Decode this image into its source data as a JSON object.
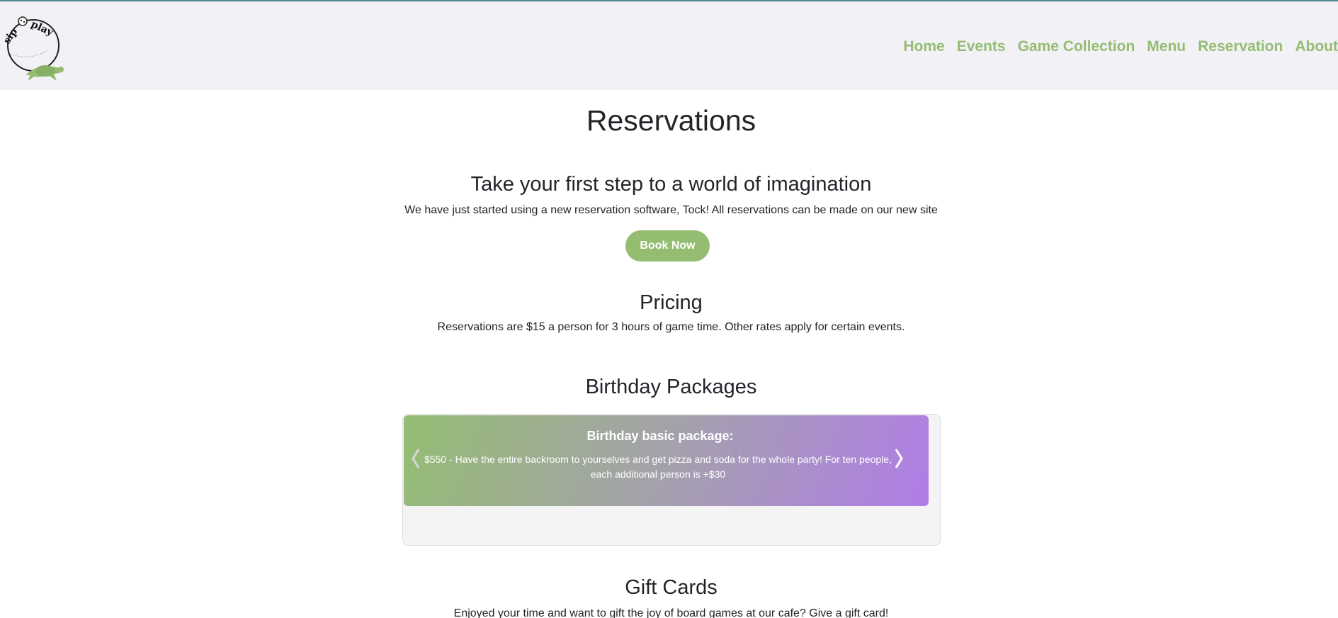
{
  "nav": {
    "logo_text": "sip & play",
    "links": [
      "Home",
      "Events",
      "Game Collection",
      "Menu",
      "Reservation",
      "About"
    ]
  },
  "page": {
    "title": "Reservations"
  },
  "intro": {
    "heading": "Take your first step to a world of imagination",
    "text": "We have just started using a new reservation software, Tock! All reservations can be made on our new site",
    "button": "Book Now"
  },
  "pricing": {
    "heading": "Pricing",
    "text": "Reservations are $15 a person for 3 hours of game time. Other rates apply for certain events."
  },
  "birthday": {
    "heading": "Birthday Packages",
    "slide_title": "Birthday basic package:",
    "slide_text": "$550 - Have the entire backroom to yourselves and get pizza and soda for the whole party! For ten people, each additional person is +$30"
  },
  "giftcards": {
    "heading": "Gift Cards",
    "text": "Enjoyed your time and want to gift the joy of board games at our cafe? Give a gift card!"
  },
  "colors": {
    "accent": "#94bd72",
    "navbar_bg": "#f2f1f6",
    "gradient_end": "#b07de7"
  }
}
